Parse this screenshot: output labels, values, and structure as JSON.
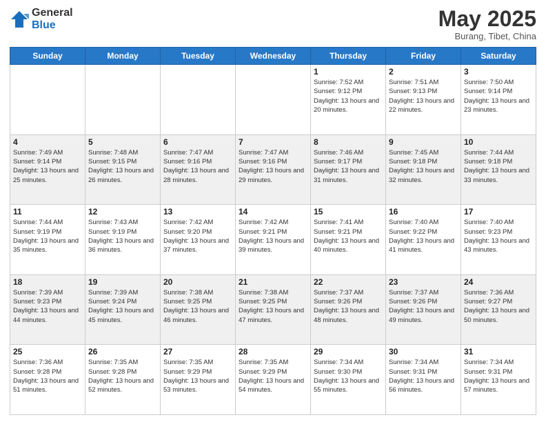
{
  "logo": {
    "general": "General",
    "blue": "Blue"
  },
  "title": "May 2025",
  "subtitle": "Burang, Tibet, China",
  "days_of_week": [
    "Sunday",
    "Monday",
    "Tuesday",
    "Wednesday",
    "Thursday",
    "Friday",
    "Saturday"
  ],
  "weeks": [
    [
      {
        "day": "",
        "info": ""
      },
      {
        "day": "",
        "info": ""
      },
      {
        "day": "",
        "info": ""
      },
      {
        "day": "",
        "info": ""
      },
      {
        "day": "1",
        "info": "Sunrise: 7:52 AM\nSunset: 9:12 PM\nDaylight: 13 hours and 20 minutes."
      },
      {
        "day": "2",
        "info": "Sunrise: 7:51 AM\nSunset: 9:13 PM\nDaylight: 13 hours and 22 minutes."
      },
      {
        "day": "3",
        "info": "Sunrise: 7:50 AM\nSunset: 9:14 PM\nDaylight: 13 hours and 23 minutes."
      }
    ],
    [
      {
        "day": "4",
        "info": "Sunrise: 7:49 AM\nSunset: 9:14 PM\nDaylight: 13 hours and 25 minutes."
      },
      {
        "day": "5",
        "info": "Sunrise: 7:48 AM\nSunset: 9:15 PM\nDaylight: 13 hours and 26 minutes."
      },
      {
        "day": "6",
        "info": "Sunrise: 7:47 AM\nSunset: 9:16 PM\nDaylight: 13 hours and 28 minutes."
      },
      {
        "day": "7",
        "info": "Sunrise: 7:47 AM\nSunset: 9:16 PM\nDaylight: 13 hours and 29 minutes."
      },
      {
        "day": "8",
        "info": "Sunrise: 7:46 AM\nSunset: 9:17 PM\nDaylight: 13 hours and 31 minutes."
      },
      {
        "day": "9",
        "info": "Sunrise: 7:45 AM\nSunset: 9:18 PM\nDaylight: 13 hours and 32 minutes."
      },
      {
        "day": "10",
        "info": "Sunrise: 7:44 AM\nSunset: 9:18 PM\nDaylight: 13 hours and 33 minutes."
      }
    ],
    [
      {
        "day": "11",
        "info": "Sunrise: 7:44 AM\nSunset: 9:19 PM\nDaylight: 13 hours and 35 minutes."
      },
      {
        "day": "12",
        "info": "Sunrise: 7:43 AM\nSunset: 9:19 PM\nDaylight: 13 hours and 36 minutes."
      },
      {
        "day": "13",
        "info": "Sunrise: 7:42 AM\nSunset: 9:20 PM\nDaylight: 13 hours and 37 minutes."
      },
      {
        "day": "14",
        "info": "Sunrise: 7:42 AM\nSunset: 9:21 PM\nDaylight: 13 hours and 39 minutes."
      },
      {
        "day": "15",
        "info": "Sunrise: 7:41 AM\nSunset: 9:21 PM\nDaylight: 13 hours and 40 minutes."
      },
      {
        "day": "16",
        "info": "Sunrise: 7:40 AM\nSunset: 9:22 PM\nDaylight: 13 hours and 41 minutes."
      },
      {
        "day": "17",
        "info": "Sunrise: 7:40 AM\nSunset: 9:23 PM\nDaylight: 13 hours and 43 minutes."
      }
    ],
    [
      {
        "day": "18",
        "info": "Sunrise: 7:39 AM\nSunset: 9:23 PM\nDaylight: 13 hours and 44 minutes."
      },
      {
        "day": "19",
        "info": "Sunrise: 7:39 AM\nSunset: 9:24 PM\nDaylight: 13 hours and 45 minutes."
      },
      {
        "day": "20",
        "info": "Sunrise: 7:38 AM\nSunset: 9:25 PM\nDaylight: 13 hours and 46 minutes."
      },
      {
        "day": "21",
        "info": "Sunrise: 7:38 AM\nSunset: 9:25 PM\nDaylight: 13 hours and 47 minutes."
      },
      {
        "day": "22",
        "info": "Sunrise: 7:37 AM\nSunset: 9:26 PM\nDaylight: 13 hours and 48 minutes."
      },
      {
        "day": "23",
        "info": "Sunrise: 7:37 AM\nSunset: 9:26 PM\nDaylight: 13 hours and 49 minutes."
      },
      {
        "day": "24",
        "info": "Sunrise: 7:36 AM\nSunset: 9:27 PM\nDaylight: 13 hours and 50 minutes."
      }
    ],
    [
      {
        "day": "25",
        "info": "Sunrise: 7:36 AM\nSunset: 9:28 PM\nDaylight: 13 hours and 51 minutes."
      },
      {
        "day": "26",
        "info": "Sunrise: 7:35 AM\nSunset: 9:28 PM\nDaylight: 13 hours and 52 minutes."
      },
      {
        "day": "27",
        "info": "Sunrise: 7:35 AM\nSunset: 9:29 PM\nDaylight: 13 hours and 53 minutes."
      },
      {
        "day": "28",
        "info": "Sunrise: 7:35 AM\nSunset: 9:29 PM\nDaylight: 13 hours and 54 minutes."
      },
      {
        "day": "29",
        "info": "Sunrise: 7:34 AM\nSunset: 9:30 PM\nDaylight: 13 hours and 55 minutes."
      },
      {
        "day": "30",
        "info": "Sunrise: 7:34 AM\nSunset: 9:31 PM\nDaylight: 13 hours and 56 minutes."
      },
      {
        "day": "31",
        "info": "Sunrise: 7:34 AM\nSunset: 9:31 PM\nDaylight: 13 hours and 57 minutes."
      }
    ]
  ]
}
